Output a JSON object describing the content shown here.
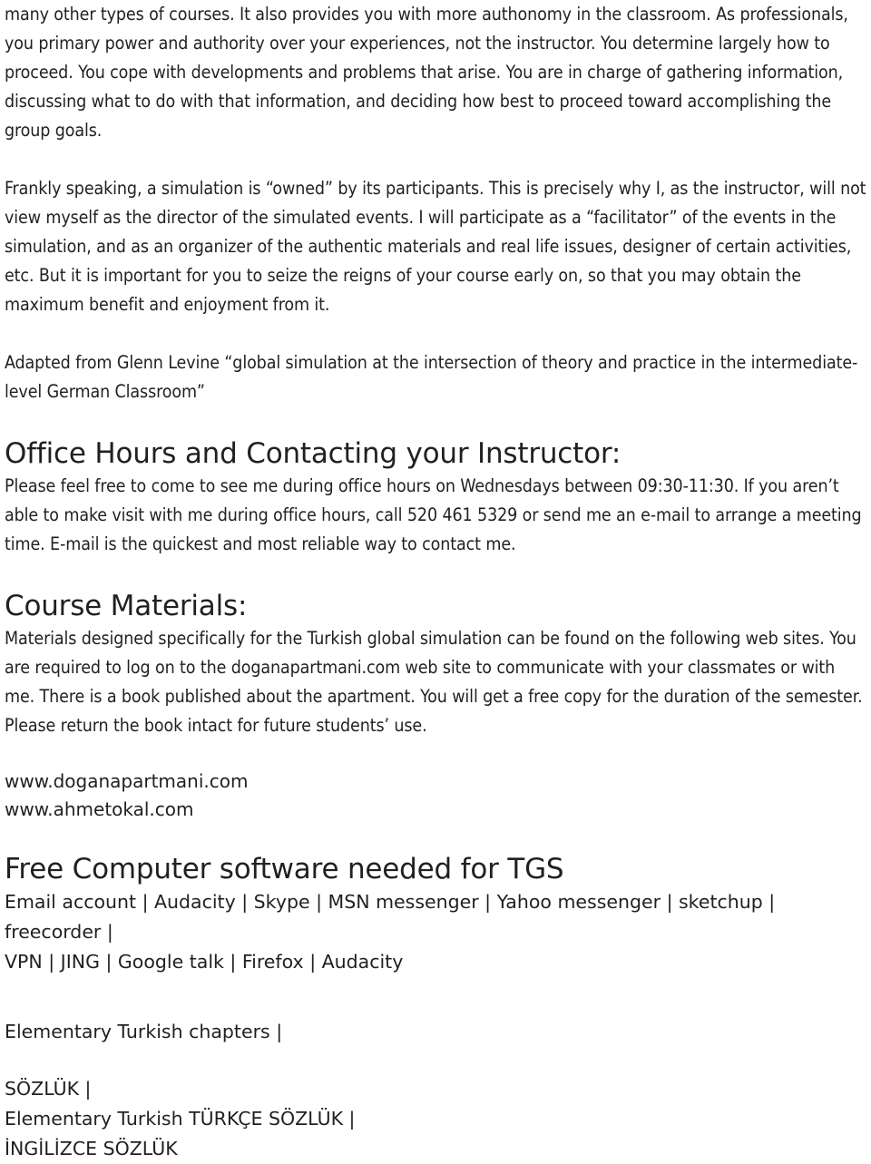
{
  "document": {
    "paragraphs": {
      "autonomy": "many other types of courses. It also provides you with more authonomy in the classroom. As professionals, you primary power and authority over your experiences, not the instructor. You determine largely how to proceed. You cope with developments and problems that arise. You are in charge of gathering information, discussing what to do with that information, and deciding how best to proceed toward accomplishing the group goals.",
      "ownership": "Frankly speaking, a simulation is “owned” by its participants. This is precisely why I, as the instructor, will not view myself as the director of the simulated events. I will participate as a “facilitator” of the events in the simulation, and as an organizer of the authentic materials and real life issues, designer of certain activities, etc. But it is important for you to seize the reigns of your course early on, so that you may obtain the maximum benefit and enjoyment from it.",
      "attribution": "Adapted from Glenn Levine “global simulation at the intersection of theory and practice in the intermediate-level German Classroom”",
      "office_hours_body": "Please feel free to come to see me during office hours on Wednesdays between 09:30-11:30. If you aren’t able to make visit with me during office hours, call 520 461 5329 or send me an e-mail to arrange a meeting time. E-mail is the quickest and most reliable way to contact me.",
      "course_materials_body": "Materials designed specifically for the Turkish global simulation can be found on the following web sites. You are required to log on to the doganapartmani.com web site to communicate with your classmates or with me. There is a book published about the apartment. You will get a free copy for the duration of the semester. Please return the book intact for future students’ use."
    },
    "headings": {
      "office_hours": "Office Hours and Contacting your Instructor:",
      "course_materials": "Course Materials:",
      "free_software": "Free Computer software needed for TGS"
    },
    "links": {
      "site_1": "www.doganapartmani.com",
      "site_2": "www.ahmetokal.com"
    },
    "software_list": {
      "line_1": "Email account | Audacity | Skype | MSN messenger | Yahoo messenger | sketchup | freecorder |",
      "line_2": "VPN | JING | Google talk | Firefox | Audacity"
    },
    "resources": {
      "chapters": "Elementary Turkish chapters |",
      "sozluk": "SÖZLÜK |",
      "turkce_sozluk": "Elementary Turkish TÜRKÇE SÖZLÜK |",
      "ingilizce_sozluk": "İNGİLİZCE SÖZLÜK"
    },
    "colors": {
      "text": "#231f20",
      "background": "#ffffff"
    }
  }
}
